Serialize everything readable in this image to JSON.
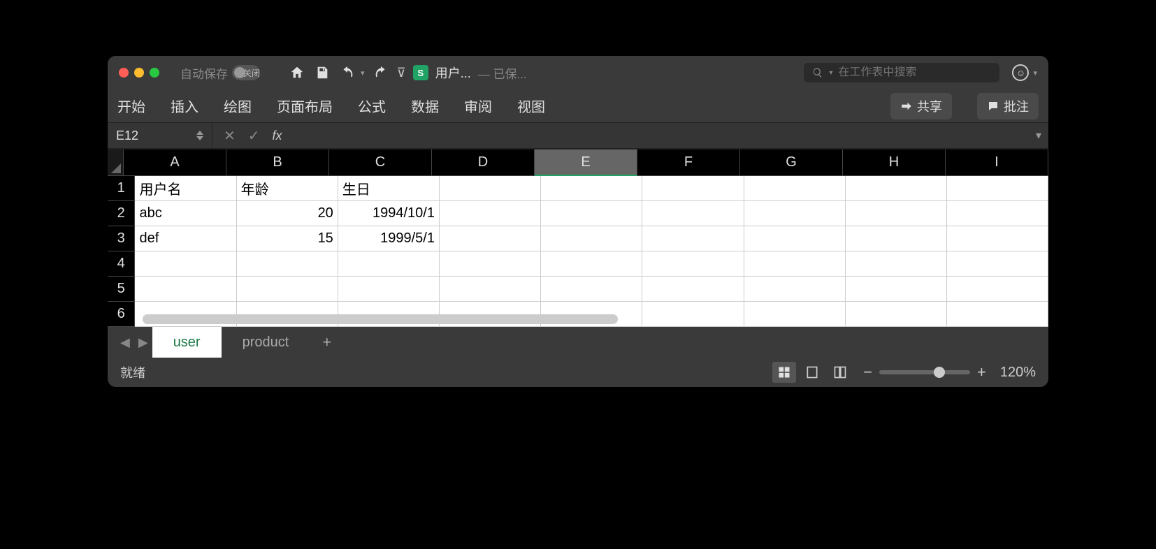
{
  "titlebar": {
    "autosave_label": "自动保存",
    "autosave_state": "关闭",
    "document_title": "用户...",
    "save_status": "— 已保...",
    "search_placeholder": "在工作表中搜索"
  },
  "ribbon": {
    "tabs": [
      "开始",
      "插入",
      "绘图",
      "页面布局",
      "公式",
      "数据",
      "审阅",
      "视图"
    ],
    "share_label": "共享",
    "comment_label": "批注"
  },
  "formula_bar": {
    "name_box": "E12",
    "formula_value": ""
  },
  "grid": {
    "columns": [
      "A",
      "B",
      "C",
      "D",
      "E",
      "F",
      "G",
      "H",
      "I"
    ],
    "active_column": "E",
    "rows": [
      1,
      2,
      3,
      4,
      5,
      6
    ],
    "cells": {
      "A1": "用户名",
      "B1": "年龄",
      "C1": "生日",
      "A2": "abc",
      "B2": "20",
      "C2": "1994/10/1",
      "A3": "def",
      "B3": "15",
      "C3": "1999/5/1"
    },
    "right_aligned_cols": [
      "B",
      "C"
    ]
  },
  "sheet_tabs": {
    "tabs": [
      {
        "name": "user",
        "active": true
      },
      {
        "name": "product",
        "active": false
      }
    ]
  },
  "status_bar": {
    "status": "就绪",
    "zoom": "120%"
  },
  "colors": {
    "accent_green": "#22a366"
  }
}
